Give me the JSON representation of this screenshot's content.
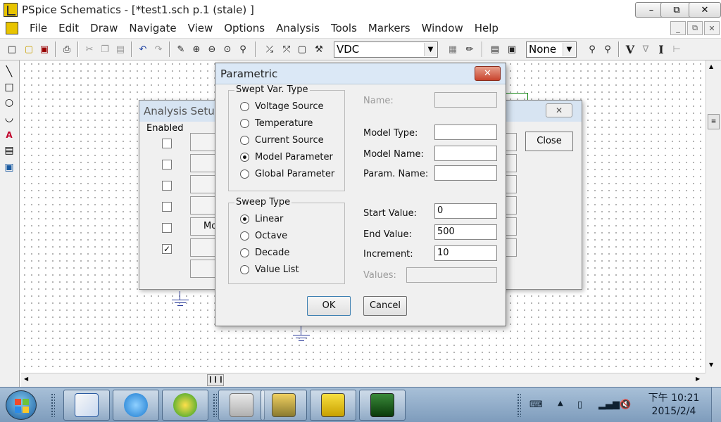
{
  "window": {
    "title": "PSpice Schematics - [*test1.sch  p.1 (stale)  ]",
    "min_label": "–",
    "max_label": "⧉",
    "close_label": "✕",
    "mdi_min": "_",
    "mdi_restore": "⧉",
    "mdi_close": "✕"
  },
  "menu": [
    "File",
    "Edit",
    "Draw",
    "Navigate",
    "View",
    "Options",
    "Analysis",
    "Tools",
    "Markers",
    "Window",
    "Help"
  ],
  "toolbar": {
    "part_combo": "VDC",
    "net_combo": "None",
    "v_label": "V",
    "i_label": "I"
  },
  "analysis_setup": {
    "title": "Analysis Setup",
    "enabled_label": "Enabled",
    "close_button": "Close",
    "partial_label": "Mo",
    "checks": [
      false,
      false,
      false,
      false,
      false,
      true
    ]
  },
  "parametric": {
    "title": "Parametric",
    "close_icon": "✕",
    "swept_var": {
      "group_label": "Swept Var. Type",
      "options": [
        "Voltage Source",
        "Temperature",
        "Current Source",
        "Model Parameter",
        "Global Parameter"
      ],
      "selected": 3
    },
    "sweep_type": {
      "group_label": "Sweep Type",
      "options": [
        "Linear",
        "Octave",
        "Decade",
        "Value List"
      ],
      "selected": 0
    },
    "fields": {
      "name_label": "Name:",
      "model_type_label": "Model Type:",
      "model_name_label": "Model Name:",
      "param_name_label": "Param. Name:",
      "start_label": "Start Value:",
      "start_value": "0",
      "end_label": "End Value:",
      "end_value": "500",
      "increment_label": "Increment:",
      "increment_value": "10",
      "values_label": "Values:"
    },
    "ok_button": "OK",
    "cancel_button": "Cancel"
  },
  "taskbar": {
    "clock_time": "下午 10:21",
    "clock_date": "2015/2/4",
    "app_icons": [
      "notes-app-icon",
      "internet-explorer-icon",
      "refresh-app-icon",
      "error-log-icon",
      "schematic-editor-icon",
      "pspice-icon",
      "probe-waveform-icon"
    ]
  },
  "colors": {
    "canvas_bg": "#ffffff",
    "grid_dot": "#9a9a9a",
    "ground_symbol": "#2a3b9a",
    "dialog_caption": "#dbe8f6",
    "close_button": "#c8442e",
    "taskbar": "#8aa8c8"
  }
}
